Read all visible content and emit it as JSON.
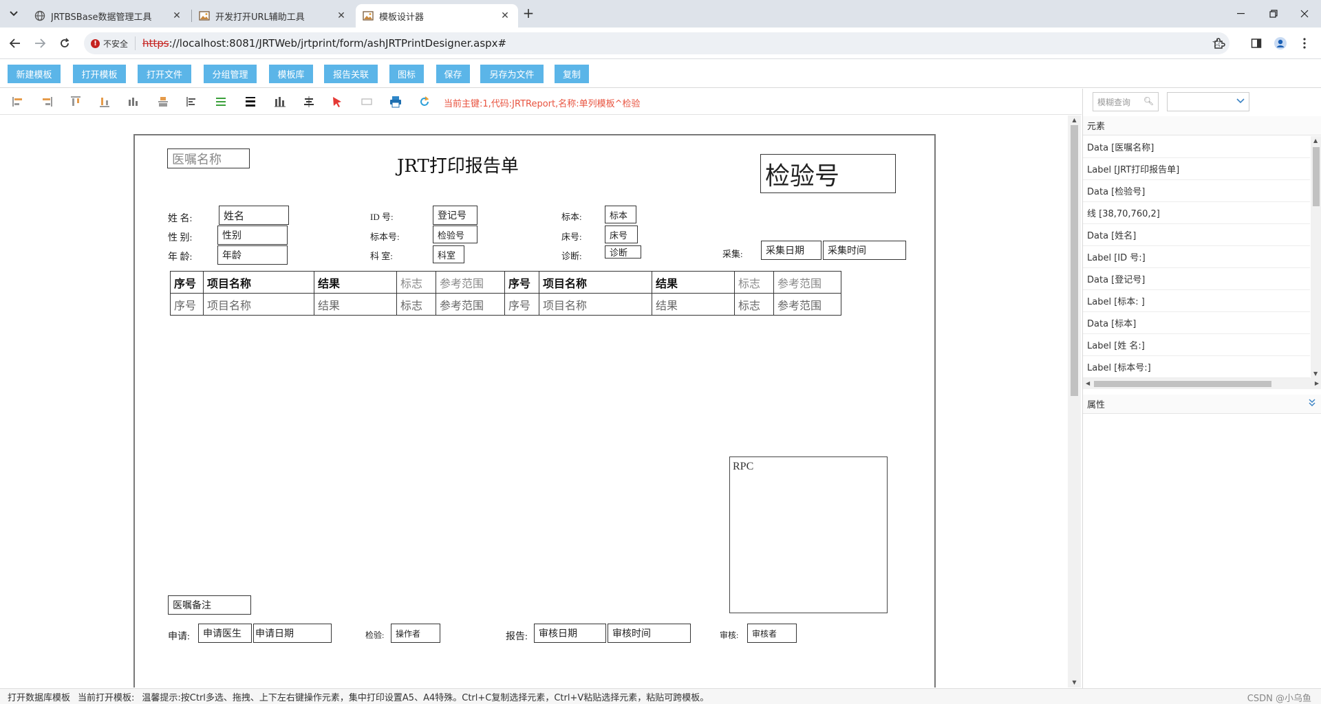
{
  "browser": {
    "tabs": [
      {
        "label": "JRTBSBase数据管理工具",
        "active": false
      },
      {
        "label": "开发打开URL辅助工具",
        "active": false
      },
      {
        "label": "模板设计器",
        "active": true
      }
    ],
    "security_label": "不安全",
    "url_protocol": "https",
    "url_rest": "://localhost:8081/JRTWeb/jrtprint/form/ashJRTPrintDesigner.aspx#"
  },
  "app_buttons": [
    "新建模板",
    "打开模板",
    "打开文件",
    "分组管理",
    "模板库",
    "报告关联",
    "图标",
    "保存",
    "另存为文件",
    "复制"
  ],
  "notice": "当前主键:1,代码:JRTReport,名称:单列模板^检验",
  "template": {
    "doctor_order_name": "医嘱名称",
    "title": "JRT打印报告单",
    "exam_no": "检验号",
    "name_label": "姓 名:",
    "name_value": "姓名",
    "gender_label": "性 别:",
    "gender_value": "性别",
    "age_label": "年 龄:",
    "age_value": "年龄",
    "id_label": "ID  号:",
    "id_value": "登记号",
    "spec_no_label": "标本号:",
    "spec_no_value": "检验号",
    "dept_label": "科  室:",
    "dept_value": "科室",
    "specimen_label": "标本:",
    "specimen_value": "标本",
    "bed_label": "床号:",
    "bed_value": "床号",
    "diag_label": "诊断:",
    "diag_value": "诊断",
    "collect_label": "采集:",
    "collect_date": "采集日期",
    "collect_time": "采集时间",
    "table_head": [
      "序号",
      "项目名称",
      "结果",
      "标志",
      "参考范围",
      "序号",
      "项目名称",
      "结果",
      "标志",
      "参考范围"
    ],
    "table_row": [
      "序号",
      "项目名称",
      "结果",
      "标志",
      "参考范围",
      "序号",
      "项目名称",
      "结果",
      "标志",
      "参考范围"
    ],
    "rpc": "RPC",
    "order_note": "医嘱备注",
    "apply_label": "申请:",
    "apply_doctor": "申请医生",
    "apply_date": "申请日期",
    "test_label": "检验:",
    "operator": "操作者",
    "report_label": "报告:",
    "review_date": "审核日期",
    "review_time": "审核时间",
    "review_label": "审核:",
    "reviewer": "审核者"
  },
  "panel": {
    "search_placeholder": "模糊查询",
    "elements_title": "元素",
    "elements": [
      "Data [医嘱名称]",
      "Label [JRT打印报告单]",
      "Data [检验号]",
      "线 [38,70,760,2]",
      "Data [姓名]",
      "Label [ID 号:]",
      "Data [登记号]",
      "Label [标本: ]",
      "Data [标本]",
      "Label [姓 名:]",
      "Label [标本号:]"
    ],
    "props_title": "属性"
  },
  "status": {
    "open_db": "打开数据库模板",
    "current": "当前打开模板:",
    "tip": "温馨提示:按Ctrl多选、拖拽、上下左右键操作元素，集中打印设置A5、A4特殊。Ctrl+C复制选择元素，Ctrl+V粘贴选择元素，粘贴可跨模板。",
    "watermark": "CSDN @小乌鱼"
  }
}
